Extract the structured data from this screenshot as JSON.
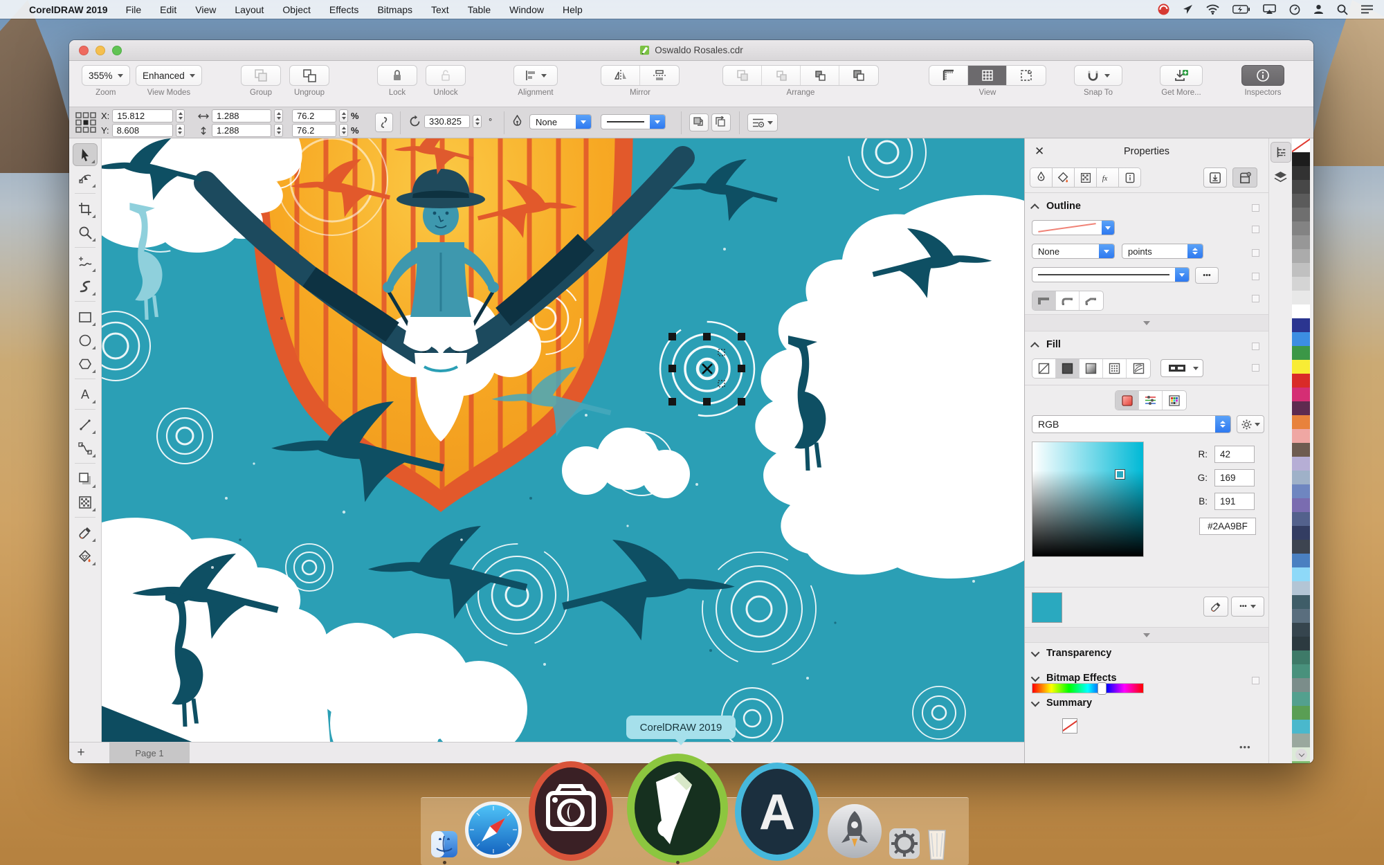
{
  "menu_bar": {
    "app_name": "CorelDRAW 2019",
    "items": [
      "File",
      "Edit",
      "View",
      "Layout",
      "Object",
      "Effects",
      "Bitmaps",
      "Text",
      "Table",
      "Window",
      "Help"
    ],
    "status_icon_names": [
      "antivirus-icon",
      "location-icon",
      "wifi-icon",
      "battery-icon",
      "airplay-icon",
      "time-machine-icon",
      "user-icon",
      "search-icon",
      "menu-list-icon"
    ]
  },
  "window": {
    "title": "Oswaldo Rosales.cdr",
    "toolbar": {
      "zoom_value": "355%",
      "zoom_label": "Zoom",
      "view_mode_value": "Enhanced",
      "view_modes_label": "View Modes",
      "group_label": "Group",
      "ungroup_label": "Ungroup",
      "lock_label": "Lock",
      "unlock_label": "Unlock",
      "alignment_label": "Alignment",
      "mirror_label": "Mirror",
      "arrange_label": "Arrange",
      "view_label": "View",
      "snap_to_label": "Snap To",
      "get_more_label": "Get More...",
      "inspectors_label": "Inspectors"
    },
    "property_bar": {
      "x_label": "X:",
      "x_value": "15.812",
      "y_label": "Y:",
      "y_value": "8.608",
      "width_value": "1.288",
      "height_value": "1.288",
      "scale_w_value": "76.2",
      "scale_h_value": "76.2",
      "percent": "%",
      "rotation_value": "330.825",
      "degree_symbol": "°",
      "outline_width_value": "None"
    },
    "page_bar": {
      "add_page_label": "+",
      "page_tab_label": "Page 1"
    }
  },
  "canvas": {
    "dock_tooltip": "CorelDRAW 2019"
  },
  "properties_panel": {
    "title": "Properties",
    "outline_section": {
      "label": "Outline",
      "width_value": "None",
      "units_value": "points"
    },
    "fill_section": {
      "label": "Fill",
      "color_model_value": "RGB",
      "r_label": "R:",
      "r_value": "42",
      "g_label": "G:",
      "g_value": "169",
      "b_label": "B:",
      "b_value": "191",
      "hex_value": "#2AA9BF"
    },
    "transparency_section_label": "Transparency",
    "bitmap_effects_section_label": "Bitmap Effects",
    "summary_section_label": "Summary",
    "ellipsis_label": "•••"
  },
  "toolbox": {
    "tool_names": [
      "pick-tool",
      "shape-tool",
      "crop-tool",
      "zoom-tool",
      "freehand-tool",
      "artistic-media-tool",
      "rectangle-tool",
      "ellipse-tool",
      "polygon-tool",
      "text-tool",
      "line-tool",
      "connector-tool",
      "drop-shadow-tool",
      "transparency-tool",
      "color-eyedropper-tool",
      "interactive-fill-tool"
    ]
  },
  "dock": {
    "item_names": [
      "finder",
      "safari",
      "corel-photo-paint",
      "coreldraw-2019",
      "corel-font-manager",
      "launchpad",
      "system-preferences",
      "trash"
    ]
  },
  "color_palette": {
    "swatches": [
      "none",
      "#1d1d1d",
      "#323232",
      "#474747",
      "#5b5b5b",
      "#6f6f6f",
      "#838383",
      "#979797",
      "#ababab",
      "#c0c0c0",
      "#d4d4d4",
      "#e8e8e8",
      "#ffffff",
      "#2b3590",
      "#3c8ee2",
      "#3b9747",
      "#f8ec35",
      "#d92b28",
      "#d52e74",
      "#5e2b50",
      "#e8823c",
      "#efa7a3",
      "#6e5c50",
      "#b6aed5",
      "#9fb1c8",
      "#6f86c0",
      "#7a6cb0",
      "#53618c",
      "#333d62",
      "#3d4450",
      "#4a80c1",
      "#8ed9f8",
      "#b3c5d5",
      "#3f5d68",
      "#5a6e7e",
      "#36454e",
      "#2c3a40",
      "#3e7a68",
      "#49917c",
      "#7b8d8a",
      "#53a08e",
      "#5a9e54",
      "#4ab8cc",
      "#9aa89e",
      "#dcead8",
      "#7cba6e"
    ]
  },
  "colors": {
    "accent_blue": "#2e79f0",
    "current_fill": "#2AA9BF",
    "canvas_teal": "#2B9FB5",
    "bird_dark_teal": "#0E4F63",
    "shield_orange": "#E2592B",
    "shield_yellow": "#F7A823"
  }
}
